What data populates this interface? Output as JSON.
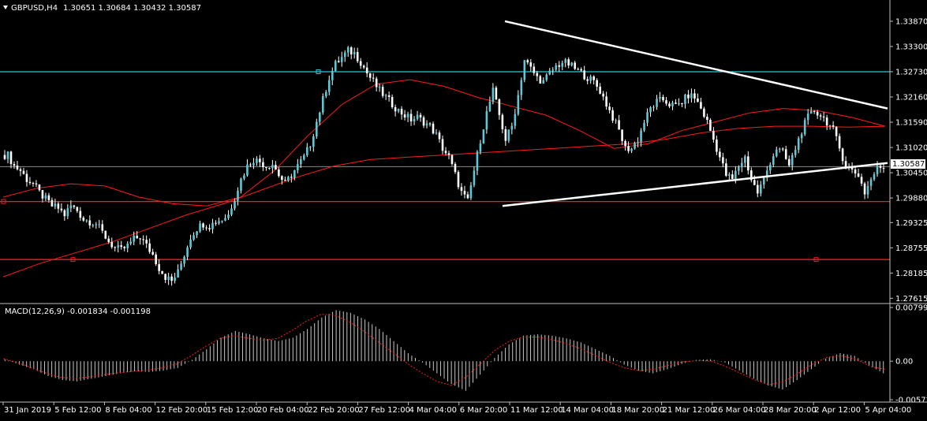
{
  "window": {
    "symbol_label": "GBPUSD,H4",
    "ohlc_label": "1.30651 1.30684 1.30432 1.30587"
  },
  "colors": {
    "background": "#000000",
    "bull_body": "#5fc8d4",
    "bear_body": "#ffffff",
    "wick": "#ffffff",
    "ma_line": "#ff1a1a",
    "support_line": "#ff1a1a",
    "resistance_line": "#2ec8d8",
    "trendline": "#ffffff",
    "macd_hist": "#c8c8c8",
    "macd_signal": "#ff1a1a",
    "axis_text": "#ffffff"
  },
  "price_axis": {
    "ticks": [
      "1.33870",
      "1.33300",
      "1.32730",
      "1.32160",
      "1.31590",
      "1.31020",
      "1.30450",
      "1.29880",
      "1.29325",
      "1.28755",
      "1.28185",
      "1.27615"
    ],
    "current_price": "1.30587"
  },
  "time_axis": {
    "labels": [
      "31 Jan 2019",
      "5 Feb 12:00",
      "8 Feb 04:00",
      "12 Feb 20:00",
      "15 Feb 12:00",
      "20 Feb 04:00",
      "22 Feb 20:00",
      "27 Feb 12:00",
      "4 Mar 04:00",
      "6 Mar 20:00",
      "11 Mar 12:00",
      "14 Mar 04:00",
      "18 Mar 20:00",
      "21 Mar 12:00",
      "26 Mar 04:00",
      "28 Mar 20:00",
      "2 Apr 12:00",
      "5 Apr 04:00"
    ]
  },
  "macd": {
    "label": "MACD(12,26,9) -0.001834 -0.001198",
    "ticks": [
      "0.007995",
      "0.00",
      "-0.005727"
    ]
  },
  "chart_data": [
    {
      "type": "candlestick",
      "symbol": "GBPUSD",
      "timeframe": "H4",
      "ylim": [
        1.2755,
        1.341
      ],
      "last_bar": {
        "open": 1.30651,
        "high": 1.30684,
        "low": 1.30432,
        "close": 1.30587
      },
      "closes": [
        1.3085,
        1.306,
        1.305,
        1.303,
        1.302,
        1.3,
        1.2985,
        1.297,
        1.2965,
        1.295,
        1.297,
        1.296,
        1.294,
        1.2935,
        1.293,
        1.291,
        1.289,
        1.2875,
        1.287,
        1.288,
        1.2895,
        1.29,
        1.288,
        1.286,
        1.283,
        1.281,
        1.28,
        1.282,
        1.286,
        1.29,
        1.292,
        1.293,
        1.2925,
        1.2935,
        1.294,
        1.295,
        1.299,
        1.303,
        1.306,
        1.3075,
        1.307,
        1.306,
        1.3065,
        1.304,
        1.302,
        1.304,
        1.306,
        1.308,
        1.311,
        1.316,
        1.321,
        1.326,
        1.329,
        1.3305,
        1.332,
        1.3315,
        1.3295,
        1.327,
        1.325,
        1.323,
        1.3215,
        1.32,
        1.3185,
        1.3175,
        1.3165,
        1.317,
        1.316,
        1.315,
        1.313,
        1.31,
        1.308,
        1.304,
        1.3,
        1.298,
        1.305,
        1.312,
        1.318,
        1.323,
        1.3175,
        1.312,
        1.315,
        1.322,
        1.33,
        1.328,
        1.326,
        1.325,
        1.327,
        1.3285,
        1.3295,
        1.329,
        1.328,
        1.327,
        1.326,
        1.325,
        1.323,
        1.32,
        1.317,
        1.314,
        1.31,
        1.31,
        1.312,
        1.316,
        1.319,
        1.3205,
        1.321,
        1.32,
        1.3195,
        1.3205,
        1.322,
        1.3215,
        1.319,
        1.316,
        1.312,
        1.308,
        1.304,
        1.303,
        1.306,
        1.308,
        1.303,
        1.3,
        1.303,
        1.307,
        1.31,
        1.309,
        1.306,
        1.31,
        1.314,
        1.317,
        1.3185,
        1.3175,
        1.316,
        1.314,
        1.31,
        1.306,
        1.305,
        1.304,
        1.3,
        1.303,
        1.3055,
        1.30587
      ],
      "ma_fast": [
        1.299,
        1.301,
        1.302,
        1.3015,
        1.299,
        1.2975,
        1.297,
        1.299,
        1.305,
        1.313,
        1.32,
        1.3245,
        1.3255,
        1.324,
        1.3215,
        1.3195,
        1.3175,
        1.314,
        1.31,
        1.311,
        1.314,
        1.316,
        1.318,
        1.319,
        1.3185,
        1.317,
        1.315
      ],
      "ma_slow": [
        1.281,
        1.284,
        1.2865,
        1.289,
        1.292,
        1.295,
        1.2975,
        1.3005,
        1.3035,
        1.306,
        1.3075,
        1.308,
        1.3085,
        1.309,
        1.3095,
        1.31,
        1.3105,
        1.311,
        1.312,
        1.3135,
        1.3145,
        1.315,
        1.315,
        1.3148,
        1.315
      ],
      "horizontal_lines": [
        1.3273,
        1.298,
        1.2849
      ],
      "trendlines": [
        {
          "from": [
            640,
            1.3387
          ],
          "to": [
            1125,
            1.319
          ]
        },
        {
          "from": [
            637,
            1.297
          ],
          "to": [
            1125,
            1.3067
          ]
        }
      ]
    },
    {
      "type": "bar",
      "title": "MACD(12,26,9) -0.001834 -0.001198",
      "ylim": [
        -0.005727,
        0.007995
      ],
      "histogram": [
        0.0003,
        -0.0005,
        -0.0012,
        -0.0022,
        -0.0028,
        -0.003,
        -0.0026,
        -0.0022,
        -0.0018,
        -0.0015,
        -0.0016,
        -0.0014,
        -0.001,
        0.0002,
        0.0018,
        0.0035,
        0.0045,
        0.004,
        0.0034,
        0.003,
        0.0035,
        0.0048,
        0.0065,
        0.0076,
        0.0072,
        0.0062,
        0.0048,
        0.003,
        0.0012,
        -0.0002,
        -0.0018,
        -0.0034,
        -0.0044,
        -0.002,
        0.0005,
        0.0025,
        0.0038,
        0.004,
        0.0038,
        0.0034,
        0.0028,
        0.0018,
        0.0008,
        -0.0005,
        -0.0014,
        -0.0018,
        -0.0012,
        -0.0004,
        0.0002,
        0.0003,
        -0.0002,
        -0.0014,
        -0.0026,
        -0.0036,
        -0.0042,
        -0.0028,
        -0.0012,
        0.0004,
        0.0012,
        0.0008,
        -0.0006,
        -0.0018
      ],
      "signal": [
        0.0004,
        -0.0002,
        -0.001,
        -0.0018,
        -0.0024,
        -0.0026,
        -0.0023,
        -0.002,
        -0.0017,
        -0.0015,
        -0.0013,
        -0.001,
        -0.0004,
        0.0008,
        0.0022,
        0.0034,
        0.0038,
        0.0034,
        0.0031,
        0.0034,
        0.0046,
        0.006,
        0.007,
        0.0068,
        0.0058,
        0.0044,
        0.0028,
        0.0012,
        -0.0004,
        -0.0018,
        -0.003,
        -0.0036,
        -0.0024,
        -0.0004,
        0.0016,
        0.003,
        0.0036,
        0.0036,
        0.0032,
        0.0026,
        0.0018,
        0.0008,
        -0.0002,
        -0.001,
        -0.0014,
        -0.0012,
        -0.0006,
        -0.0001,
        0.0001,
        0.0,
        -0.0008,
        -0.0018,
        -0.0028,
        -0.0035,
        -0.003,
        -0.0018,
        -0.0004,
        0.0006,
        0.0008,
        0.0003,
        -0.0008,
        -0.0012
      ]
    }
  ]
}
